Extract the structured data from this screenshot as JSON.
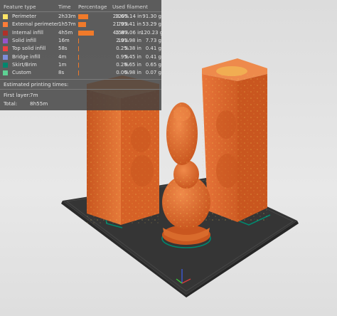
{
  "legend": {
    "headers": {
      "feature_type": "Feature type",
      "time": "Time",
      "percentage": "Percentage",
      "used_filament": "Used filament"
    },
    "rows": [
      {
        "name": "Perimeter",
        "color": "#FFE566",
        "time": "2h33m",
        "percent": "28.6%",
        "fraction": 0.286,
        "length": "1205.14 in",
        "weight": "91.30 g"
      },
      {
        "name": "External perimeter",
        "color": "#FF7D38",
        "time": "1h57m",
        "percent": "21.9%",
        "fraction": 0.219,
        "length": "703.41 in",
        "weight": "53.29 g"
      },
      {
        "name": "Internal infill",
        "color": "#B03029",
        "time": "4h5m",
        "percent": "45.8%",
        "fraction": 0.458,
        "length": "1587.06 in",
        "weight": "120.23 g"
      },
      {
        "name": "Solid infill",
        "color": "#9654CC",
        "time": "16m",
        "percent": "2.9%",
        "fraction": 0.029,
        "length": "101.98 in",
        "weight": "7.73 g"
      },
      {
        "name": "Top solid infill",
        "color": "#F04040",
        "time": "58s",
        "percent": "0.2%",
        "fraction": 0.002,
        "length": "5.38 in",
        "weight": "0.41 g"
      },
      {
        "name": "Bridge infill",
        "color": "#7D8DDA",
        "time": "4m",
        "percent": "0.9%",
        "fraction": 0.009,
        "length": "5.45 in",
        "weight": "0.41 g"
      },
      {
        "name": "Skirt/Brim",
        "color": "#00876E",
        "time": "1m",
        "percent": "0.2%",
        "fraction": 0.002,
        "length": "8.65 in",
        "weight": "0.65 g"
      },
      {
        "name": "Custom",
        "color": "#5ED194",
        "time": "8s",
        "percent": "0.0%",
        "fraction": 0.0,
        "length": "0.98 in",
        "weight": "0.07 g"
      }
    ],
    "estimated_title": "Estimated printing times:",
    "first_layer_label": "First layer:",
    "first_layer_value": "7m",
    "total_label": "Total:",
    "total_value": "8h55m"
  },
  "colors": {
    "model_orange": "#E2682A",
    "bed": "#3a3a3a",
    "skirt": "#00876E"
  }
}
